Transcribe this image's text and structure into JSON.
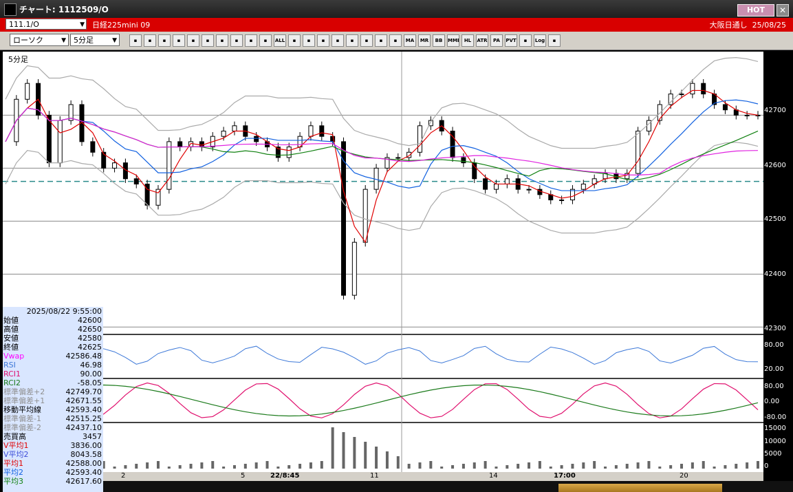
{
  "title": "チャート: 1112509/O",
  "hot_label": "HOT",
  "close_label": "✕",
  "symbol": {
    "code": "111.1/O",
    "name": "日経225mini 09",
    "exchange": "大阪日通し",
    "date": "25/08/25"
  },
  "toolbar": {
    "chart_type": "ローソク",
    "interval": "5分足",
    "buttons": [
      "search-icon",
      "grid-icon",
      "pen-icon",
      "line-icon",
      "cursor-icon",
      "rotate-icon",
      "doc-icon",
      "trash-icon",
      "bar-icon",
      "bar2-icon",
      "ALL",
      "tools-icon",
      "wrench-icon",
      "color-icon",
      "print-icon",
      "clock-icon",
      "chart-icon",
      "cross-icon",
      "ex-icon",
      "MA",
      "MR",
      "BB",
      "MME",
      "HL",
      "ATR",
      "PA",
      "PVT",
      "box-icon",
      "Log",
      "save-icon"
    ]
  },
  "chart": {
    "interval_label": "5分足",
    "dashed_value": 42575,
    "ymin": 42290,
    "ymax": 42820
  },
  "axis": {
    "price_ticks": [
      "42700",
      "42600",
      "42500",
      "42400",
      "42300"
    ],
    "rsi_ticks": [
      "80.00",
      "20.00"
    ],
    "rci_ticks": [
      "80.00",
      "0.00",
      "-80.00"
    ],
    "vol_ticks": [
      "15000",
      "10000",
      "5000",
      "0"
    ]
  },
  "xaxis": {
    "labels": [
      "2",
      "5",
      "22/8:45",
      "11",
      "14",
      "17:00",
      "20"
    ]
  },
  "info": {
    "datetime": "2025/08/22 9:55:00",
    "rows": [
      {
        "label": "始値",
        "value": "42600",
        "color": "#000000"
      },
      {
        "label": "高値",
        "value": "42650",
        "color": "#000000"
      },
      {
        "label": "安値",
        "value": "42580",
        "color": "#000000"
      },
      {
        "label": "終値",
        "value": "42625",
        "color": "#000000"
      },
      {
        "label": "Vwap",
        "value": "42586.48",
        "color": "#ff00ff"
      },
      {
        "label": "RSI",
        "value": "46.98",
        "color": "#3c78d8"
      },
      {
        "label": "RCI1",
        "value": "90.00",
        "color": "#e0106e"
      },
      {
        "label": "RCI2",
        "value": "-58.05",
        "color": "#1a7a1a"
      },
      {
        "label": "標準偏差+2",
        "value": "42749.70",
        "color": "#909090"
      },
      {
        "label": "標準偏差+1",
        "value": "42671.55",
        "color": "#909090"
      },
      {
        "label": "移動平均線",
        "value": "42593.40",
        "color": "#000000"
      },
      {
        "label": "標準偏差-1",
        "value": "42515.25",
        "color": "#909090"
      },
      {
        "label": "標準偏差-2",
        "value": "42437.10",
        "color": "#909090"
      },
      {
        "label": "売買高",
        "value": "3457",
        "color": "#000000"
      },
      {
        "label": "V平均1",
        "value": "3836.00",
        "color": "#e00000"
      },
      {
        "label": "V平均2",
        "value": "8043.58",
        "color": "#3c4cd8"
      },
      {
        "label": "平均1",
        "value": "42588.00",
        "color": "#e00000"
      },
      {
        "label": "平均2",
        "value": "42593.40",
        "color": "#1060e0"
      },
      {
        "label": "平均3",
        "value": "42617.60",
        "color": "#108010"
      }
    ]
  },
  "chart_data": {
    "type": "line",
    "x": [
      0,
      4,
      8,
      12,
      16,
      20,
      24,
      28,
      32,
      36,
      40,
      44,
      48,
      52,
      56,
      60,
      64,
      68,
      72,
      76,
      80,
      84,
      88,
      92,
      96,
      100,
      104,
      108,
      112,
      116,
      120,
      124,
      128,
      132,
      136,
      140,
      144,
      148,
      152,
      156,
      160,
      164,
      168,
      172,
      176,
      180,
      184,
      188,
      192,
      196,
      200,
      204,
      208,
      212,
      216,
      220,
      224,
      228,
      232,
      236,
      240,
      244,
      248,
      252,
      256,
      260,
      264,
      268,
      272,
      276
    ],
    "series": [
      {
        "name": "終値",
        "values": [
          42650,
          42730,
          42760,
          42700,
          42610,
          42690,
          42720,
          42650,
          42630,
          42600,
          42610,
          42580,
          42570,
          42530,
          42560,
          42650,
          42640,
          42650,
          42640,
          42660,
          42670,
          42680,
          42660,
          42650,
          42640,
          42620,
          42640,
          42660,
          42680,
          42660,
          42650,
          42360,
          42460,
          42560,
          42600,
          42620,
          42620,
          42630,
          42680,
          42690,
          42670,
          42620,
          42610,
          42580,
          42560,
          42570,
          42580,
          42560,
          42560,
          42550,
          42540,
          42540,
          42560,
          42570,
          42580,
          42590,
          42580,
          42590,
          42670,
          42690,
          42720,
          42740,
          42740,
          42760,
          42740,
          42720,
          42710,
          42700,
          42700,
          42700
        ]
      }
    ]
  }
}
